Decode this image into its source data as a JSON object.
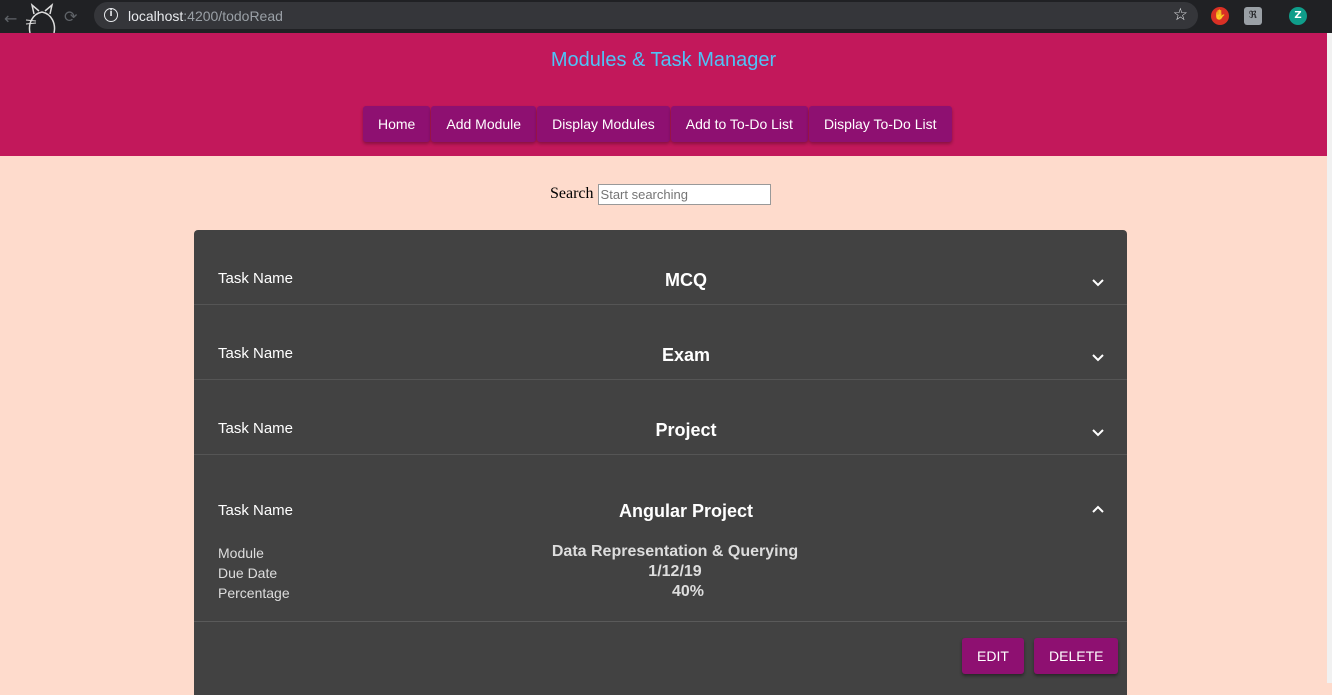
{
  "browser": {
    "url_host": "localhost",
    "url_path": ":4200/todoRead",
    "extensions": [
      "adblock-icon",
      "extension-icon",
      "profile-avatar"
    ],
    "profile_initial": "Z"
  },
  "app": {
    "title": "Modules & Task Manager",
    "nav": [
      "Home",
      "Add Module",
      "Display Modules",
      "Add to To-Do List",
      "Display To-Do List"
    ]
  },
  "search": {
    "label": "Search",
    "placeholder": "Start searching"
  },
  "tasks": [
    {
      "label": "Task Name",
      "name": "MCQ",
      "expanded": false
    },
    {
      "label": "Task Name",
      "name": "Exam",
      "expanded": false
    },
    {
      "label": "Task Name",
      "name": "Project",
      "expanded": false
    },
    {
      "label": "Task Name",
      "name": "Angular Project",
      "expanded": true,
      "details": [
        {
          "key": "Module",
          "value": "Data Representation & Querying"
        },
        {
          "key": "Due Date",
          "value": "1/12/19"
        },
        {
          "key": "Percentage",
          "value": "40%"
        }
      ],
      "actions": [
        "EDIT",
        "DELETE"
      ]
    }
  ],
  "colors": {
    "page_bg": "#fedbcc",
    "header_bg": "#c2185b",
    "title": "#4fc3f7",
    "button": "#8e1071",
    "panel": "#424242"
  }
}
